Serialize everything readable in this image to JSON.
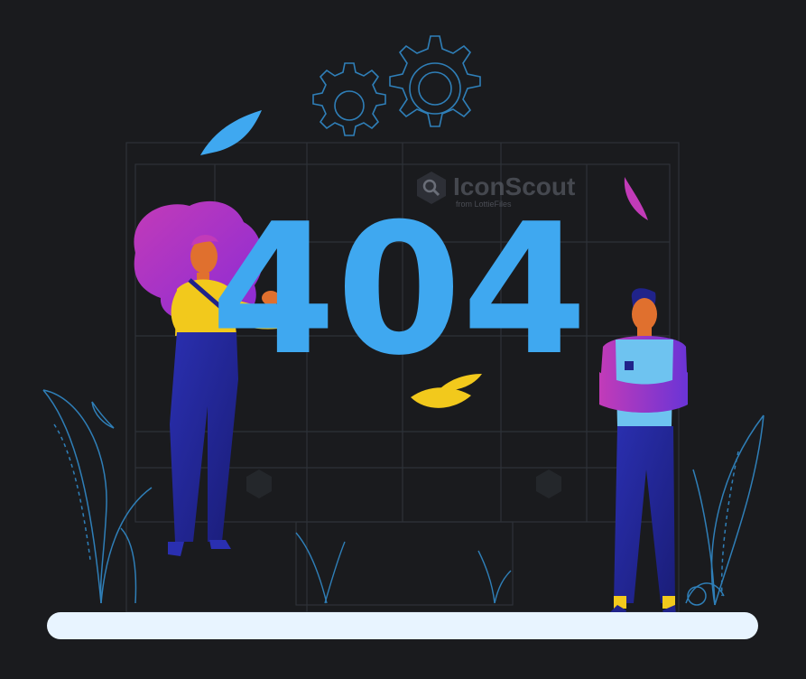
{
  "illustration": {
    "error_code": "404",
    "watermark": {
      "brand": "IconScout",
      "tagline": "from LottieFiles"
    }
  },
  "colors": {
    "background": "#1a1b1e",
    "accent_blue": "#3fa8f0",
    "outline_blue": "#2f7fb8",
    "magenta": "#c23bb8",
    "yellow": "#f2c91c",
    "navy": "#20238a",
    "floor": "#e8f4ff"
  },
  "icons": [
    "gear-icon",
    "gear-icon",
    "leaf-icon",
    "leaf-icon",
    "leaf-icon",
    "magnifier-icon"
  ]
}
